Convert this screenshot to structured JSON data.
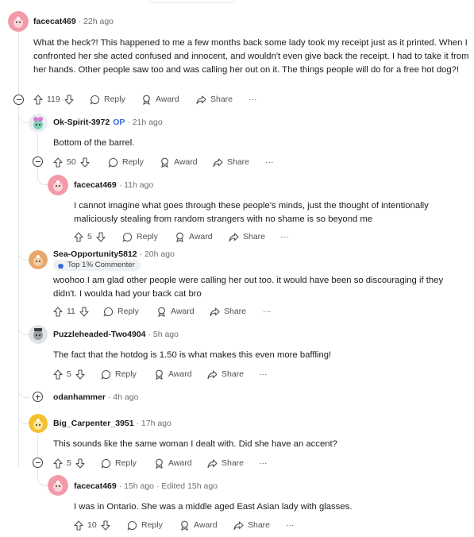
{
  "comments": [
    {
      "username": "facecat469",
      "op_tag": "",
      "time": "22h ago",
      "edited": "",
      "body": "What the heck?! This happened to me a few months back some lady took my receipt just as it printed. When I confronted her she acted confused and innocent, and wouldn't even give back the receipt. I had to take it from her hands. Other people saw too and was calling her out on it. The things people will do for a free hot dog?!",
      "votes": "119",
      "avatar": "facecat-pink"
    },
    {
      "username": "Ok-Spirit-3972",
      "op_tag": "OP",
      "time": "21h ago",
      "edited": "",
      "body": "Bottom of the barrel.",
      "votes": "50",
      "avatar": "ok-spirit"
    },
    {
      "username": "facecat469",
      "op_tag": "",
      "time": "11h ago",
      "edited": "",
      "body": "I cannot imagine what goes through these people's minds, just the thought of intentionally maliciously stealing from random strangers with no shame is so beyond me",
      "votes": "5",
      "avatar": "facecat-pink"
    },
    {
      "username": "Sea-Opportunity5812",
      "op_tag": "",
      "time": "20h ago",
      "edited": "",
      "badge": "Top 1% Commenter",
      "body": "woohoo I am glad other people were calling her out too. it would have been so discouraging if they didn't. I woulda had your back cat bro",
      "votes": "11",
      "avatar": "sea-opportunity"
    },
    {
      "username": "Puzzleheaded-Two4904",
      "op_tag": "",
      "time": "5h ago",
      "edited": "",
      "body": "The fact that the hotdog is 1.50 is what makes this even more baffling!",
      "votes": "5",
      "avatar": "puzzleheaded"
    },
    {
      "username": "odanhammer",
      "op_tag": "",
      "time": "4h ago",
      "edited": "",
      "collapsed": true
    },
    {
      "username": "Big_Carpenter_3951",
      "op_tag": "",
      "time": "17h ago",
      "edited": "",
      "body": "This sounds like the same woman I dealt with. Did she have an accent?",
      "votes": "5",
      "avatar": "big-carpenter"
    },
    {
      "username": "facecat469",
      "op_tag": "",
      "time": "15h ago",
      "edited": "Edited 15h ago",
      "body": "I was in Ontario. She was a middle aged East Asian lady with glasses.",
      "votes": "10",
      "avatar": "facecat-pink"
    }
  ],
  "actions": {
    "reply": "Reply",
    "award": "Award",
    "share": "Share",
    "more": "···"
  },
  "separator": "·",
  "colors": {
    "accent_op": "#3a6ad6",
    "thread_line": "#e1e4e6",
    "avatar_pink": "#f29aa7",
    "avatar_orange": "#e8a76b",
    "avatar_yellow": "#f2c12e"
  }
}
